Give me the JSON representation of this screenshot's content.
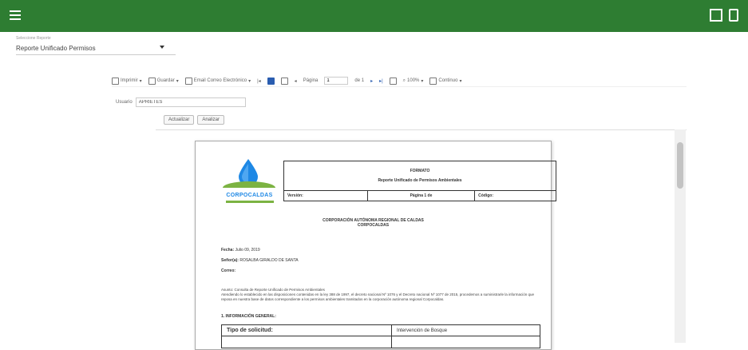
{
  "selector": {
    "label": "Seleccione Reporte",
    "value": "Reporte Unificado Permisos"
  },
  "toolbar": {
    "imprimir": "Imprimir",
    "guardar": "Guardar",
    "email": "Email Correo Electrónico",
    "pagina": "Página",
    "page_value": "1",
    "de": "de 1",
    "zoom": "100%",
    "continuo": "Continuo"
  },
  "filter": {
    "label": "Usuario",
    "value": "APRIETES"
  },
  "buttons": {
    "actualizar": "Actualizar",
    "analizar": "Analizar"
  },
  "report": {
    "logo_text": "CORPOCALDAS",
    "formato_title": "FORMATO",
    "formato_subtitle": "Reporte Unificado de Permisos Ambientales",
    "version_label": "Versión:",
    "pagina_label": "Página 1 de",
    "codigo_label": "Código:",
    "corp_line1": "CORPORACIÓN AUTÓNOMA REGIONAL DE CALDAS",
    "corp_line2": "CORPOCALDAS",
    "fecha_label": "Fecha:",
    "fecha_value": "Julio 09, 2019",
    "senor_label": "Señor(a):",
    "senor_value": "ROSALBA GIRALDO DE SANTA",
    "correo_label": "Correo:",
    "asunto": "Asunto: Consulta de Reporte Unificado de Permisos Ambientales",
    "body": "Atendiendo lo establecido en las disposiciones contenidas en la ley 388 de 1997, el decreto nacional Nº 1076 y el Decreto nacional Nº 1077 de 2015, procedemos a suministrarle la información que reposa en nuestra base de datos correspondiente a los permisos ambientales tramitados en la corporación autónoma regional Corpocaldas.",
    "section_title": "1. INFORMACIÓN GENERAL:",
    "tipo_label": "Tipo de solicitud:",
    "tipo_value": "Intervención de Bosque"
  }
}
